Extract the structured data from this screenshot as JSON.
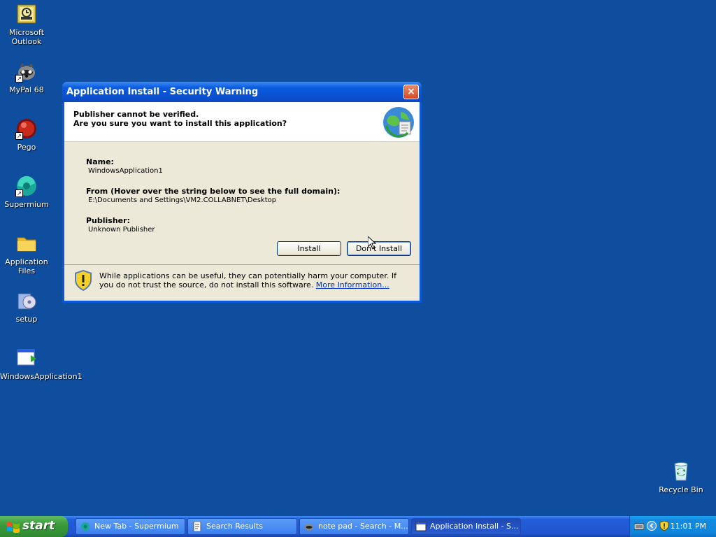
{
  "desktop": {
    "icons": [
      {
        "label": "Microsoft Outlook",
        "icon": "outlook-icon"
      },
      {
        "label": "MyPal 68",
        "icon": "mypal-icon"
      },
      {
        "label": "Pego",
        "icon": "pego-icon"
      },
      {
        "label": "Supermium",
        "icon": "supermium-icon"
      },
      {
        "label": "Application Files",
        "icon": "folder-icon"
      },
      {
        "label": "setup",
        "icon": "setup-icon"
      },
      {
        "label": "WindowsApplication1",
        "icon": "application-icon"
      },
      {
        "label": "Recycle Bin",
        "icon": "recycle-bin-icon"
      }
    ]
  },
  "dialog": {
    "title": "Application Install - Security Warning",
    "close": "×",
    "header_line1": "Publisher cannot be verified.",
    "header_line2": "Are you sure you want to install this application?",
    "name_label": "Name:",
    "name_value": "WindowsApplication1",
    "from_label": "From (Hover over the string below to see the full domain):",
    "from_value": "E:\\Documents and Settings\\VM2.COLLABNET\\Desktop",
    "publisher_label": "Publisher:",
    "publisher_value": "Unknown Publisher",
    "install_button": "Install",
    "dont_install_button": "Don't Install",
    "warning_text": "While applications can be useful, they can potentially harm your computer. If you do not trust the source, do not install this software.",
    "more_info_link": "More Information..."
  },
  "taskbar": {
    "start_label": "start",
    "tasks": [
      {
        "label": "New Tab - Supermium",
        "icon": "supermium-icon"
      },
      {
        "label": "Search Results",
        "icon": "document-icon"
      },
      {
        "label": "note pad - Search - M...",
        "icon": "mypal-icon"
      },
      {
        "label": "Application Install - S...",
        "icon": "window-icon"
      }
    ],
    "clock": "11:01 PM"
  },
  "colors": {
    "desktop_bg": "#0f4e9f",
    "titlebar": "#0a5ae0",
    "dialog_bg": "#ece9d8",
    "taskbar": "#245edb",
    "start_green": "#3c9c3c"
  }
}
